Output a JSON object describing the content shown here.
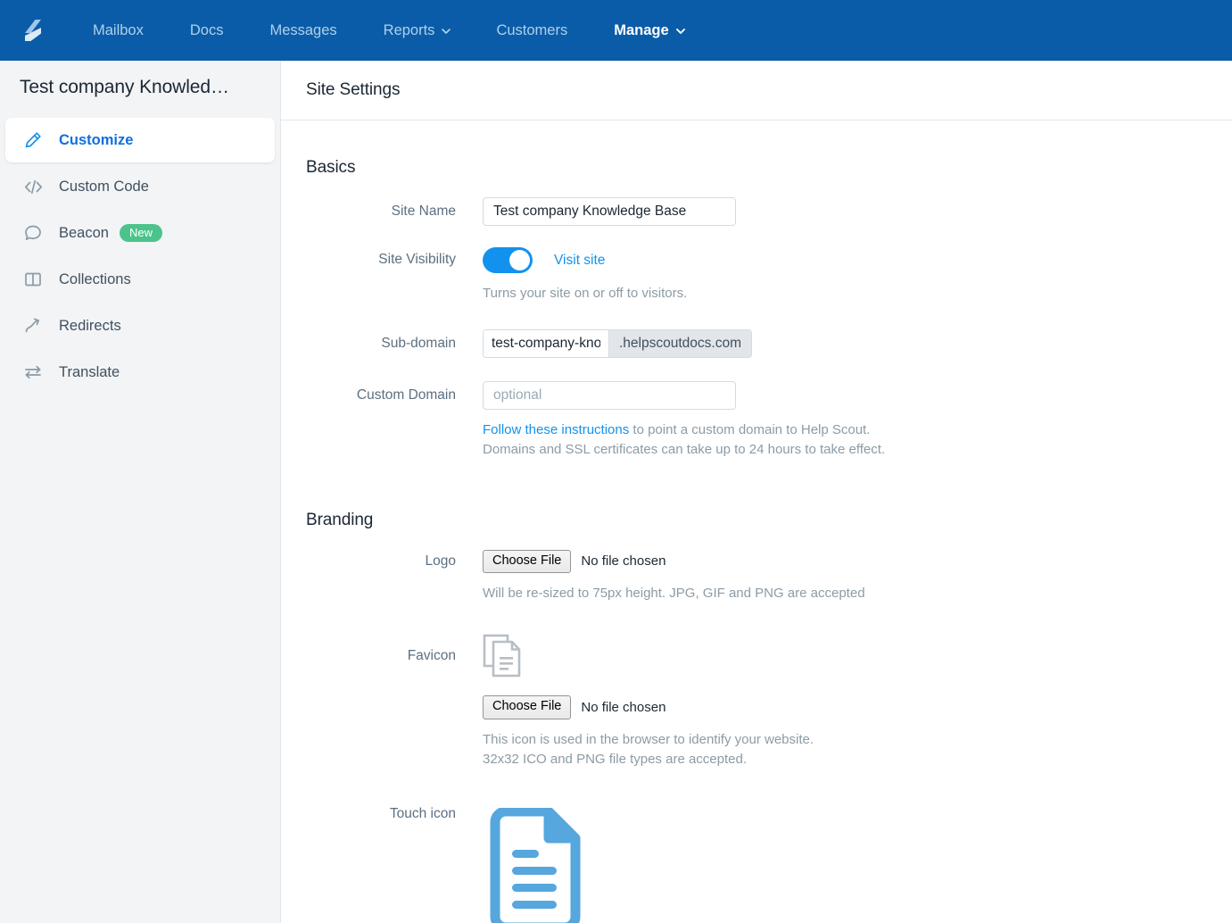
{
  "topnav": {
    "logo_icon": "helpscout-logo-icon",
    "items": [
      {
        "label": "Mailbox",
        "has_caret": false,
        "active": false
      },
      {
        "label": "Docs",
        "has_caret": false,
        "active": false
      },
      {
        "label": "Messages",
        "has_caret": false,
        "active": false
      },
      {
        "label": "Reports",
        "has_caret": true,
        "active": false
      },
      {
        "label": "Customers",
        "has_caret": false,
        "active": false
      },
      {
        "label": "Manage",
        "has_caret": true,
        "active": true
      }
    ],
    "background_color": "#0A5CA8"
  },
  "sidebar": {
    "title": "Test company Knowled…",
    "items": [
      {
        "label": "Customize",
        "icon": "pencil-icon",
        "active": true,
        "badge": null
      },
      {
        "label": "Custom Code",
        "icon": "code-brackets-icon",
        "active": false,
        "badge": null
      },
      {
        "label": "Beacon",
        "icon": "speech-bubble-icon",
        "active": false,
        "badge": "New"
      },
      {
        "label": "Collections",
        "icon": "open-book-icon",
        "active": false,
        "badge": null
      },
      {
        "label": "Redirects",
        "icon": "curved-arrow-icon",
        "active": false,
        "badge": null
      },
      {
        "label": "Translate",
        "icon": "two-way-arrows-icon",
        "active": false,
        "badge": null
      }
    ],
    "badge_color": "#4CC38A",
    "active_color": "#0F6FDE"
  },
  "main": {
    "header_title": "Site Settings",
    "basics": {
      "section_title": "Basics",
      "site_name": {
        "label": "Site Name",
        "value": "Test company Knowledge Base"
      },
      "site_visibility": {
        "label": "Site Visibility",
        "toggle_on": true,
        "link_label": "Visit site",
        "helper": "Turns your site on or off to visitors."
      },
      "sub_domain": {
        "label": "Sub-domain",
        "value": "test-company-knowledge-base",
        "suffix": ".helpscoutdocs.com"
      },
      "custom_domain": {
        "label": "Custom Domain",
        "value": "",
        "placeholder": "optional",
        "helper_link": "Follow these instructions",
        "helper_line1_rest": " to point a custom domain to Help Scout.",
        "helper_line2": "Domains and SSL certificates can take up to 24 hours to take effect."
      }
    },
    "branding": {
      "section_title": "Branding",
      "logo": {
        "label": "Logo",
        "button_label": "Choose File",
        "status": "No file chosen",
        "helper": "Will be re-sized to 75px height. JPG, GIF and PNG are accepted"
      },
      "favicon": {
        "label": "Favicon",
        "preview_icon": "document-placeholder-icon",
        "button_label": "Choose File",
        "status": "No file chosen",
        "helper_line1": "This icon is used in the browser to identify your website.",
        "helper_line2": "32x32 ICO and PNG file types are accepted."
      },
      "touch_icon": {
        "label": "Touch icon",
        "preview_icon": "blue-document-icon"
      }
    }
  }
}
